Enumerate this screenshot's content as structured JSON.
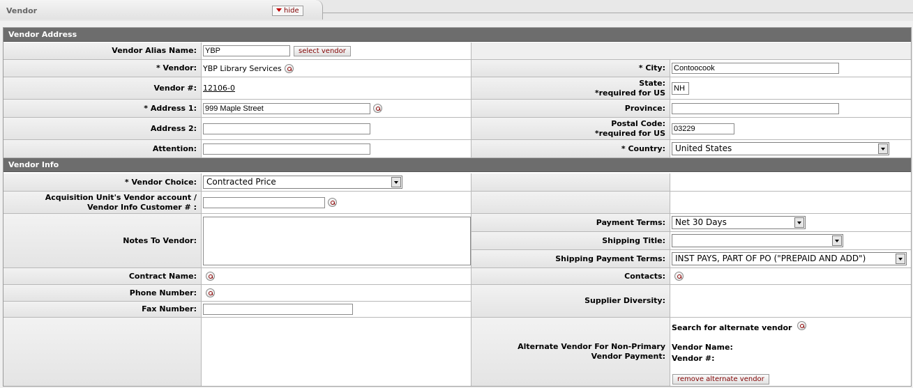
{
  "tab": {
    "title": "Vendor",
    "hide_label": "hide"
  },
  "address_section": {
    "header": "Vendor Address",
    "alias_label": "Vendor Alias Name:",
    "alias_value": "YBP",
    "select_vendor_label": "select vendor",
    "vendor_label": "*  Vendor:",
    "vendor_value": "YBP Library Services",
    "city_label": "*  City:",
    "city_value": "Contoocook",
    "vendor_num_label": "Vendor #:",
    "vendor_num_value": "12106-0",
    "state_label": "State:",
    "state_req": "*required for US",
    "state_value": "NH",
    "address1_label": "*  Address 1:",
    "address1_value": "999 Maple Street",
    "province_label": "Province:",
    "province_value": "",
    "address2_label": "Address 2:",
    "address2_value": "",
    "postal_label": "Postal Code:",
    "postal_req": "*required for US",
    "postal_value": "03229",
    "attention_label": "Attention:",
    "attention_value": "",
    "country_label": "*  Country:",
    "country_value": "United States"
  },
  "info_section": {
    "header": "Vendor Info",
    "choice_label": "*  Vendor Choice:",
    "choice_value": "Contracted Price",
    "acq_label_line1": "Acquisition Unit's Vendor account /",
    "acq_label_line2": "Vendor Info Customer # :",
    "acq_value": "",
    "notes_label": "Notes To Vendor:",
    "notes_value": "",
    "payment_terms_label": "Payment Terms:",
    "payment_terms_value": "Net 30 Days",
    "shipping_title_label": "Shipping Title:",
    "shipping_title_value": "",
    "shipping_payment_label": "Shipping Payment Terms:",
    "shipping_payment_value": "INST PAYS, PART OF PO (\"PREPAID AND ADD\")",
    "contract_label": "Contract Name:",
    "contacts_label": "Contacts:",
    "phone_label": "Phone Number:",
    "fax_label": "Fax Number:",
    "fax_value": "",
    "diversity_label": "Supplier Diversity:",
    "alt_label_line1": "Alternate Vendor For Non-Primary",
    "alt_label_line2": "Vendor Payment:",
    "alt_search_label": "Search for alternate vendor",
    "alt_name_label": "Vendor Name:",
    "alt_num_label": "Vendor #:",
    "remove_alt_label": "remove alternate vendor"
  }
}
